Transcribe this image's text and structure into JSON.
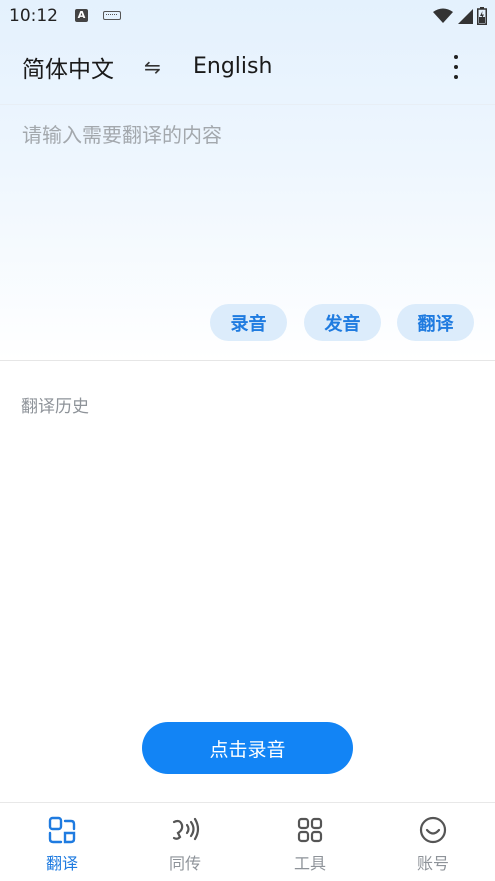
{
  "status_bar": {
    "time": "10:12",
    "a_badge": "A"
  },
  "language_bar": {
    "source_language": "简体中文",
    "swap_symbol": "⇋",
    "target_language": "English"
  },
  "input": {
    "placeholder": "请输入需要翻译的内容",
    "value": ""
  },
  "actions": {
    "record_label": "录音",
    "speak_label": "发音",
    "translate_label": "翻译"
  },
  "history": {
    "title": "翻译历史"
  },
  "record_button": {
    "label": "点击录音"
  },
  "bottom_nav": {
    "items": [
      {
        "label": "翻译",
        "icon": "scan-translate-icon",
        "active": true
      },
      {
        "label": "同传",
        "icon": "speech-wave-icon",
        "active": false
      },
      {
        "label": "工具",
        "icon": "grid-apps-icon",
        "active": false
      },
      {
        "label": "账号",
        "icon": "smiley-icon",
        "active": false
      }
    ]
  },
  "colors": {
    "accent": "#1284f5",
    "pill_bg": "#dcecfb",
    "pill_text": "#1f7be0",
    "muted": "#8e9399"
  }
}
